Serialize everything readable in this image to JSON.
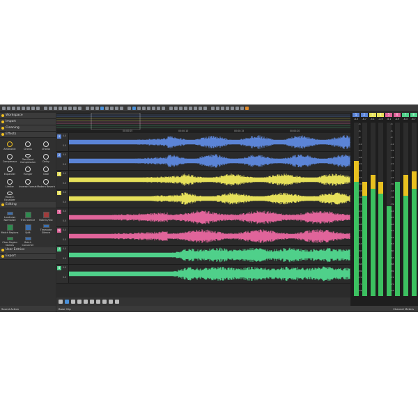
{
  "panel_sections": {
    "workspace": "Workspace",
    "import": "Import",
    "cleaning": "Cleaning",
    "effects": "Effects",
    "editing": "Editing",
    "user_entries": "User Entries",
    "export": "Export"
  },
  "effects": [
    "Ambisonic",
    "Chorus",
    "Chorus",
    "Compressor",
    "Two-Band Compression",
    "Delay",
    "Expander",
    "Flanger",
    "Gate",
    "Limiter",
    "Inverse Format",
    "Modern Reverb",
    "Modern Equalizer"
  ],
  "editing_tools": [
    "Loudness Normalize",
    "Trim Silence",
    "Fade In/Out",
    "Match Regions",
    "Split",
    "Timecode Silence",
    "Clear Region Names",
    "Batch Converter"
  ],
  "tracks": [
    {
      "num": "1",
      "color": "#5b84d6",
      "db_top": "0.0",
      "db_bottom": "0.0",
      "kind": "blue"
    },
    {
      "num": "2",
      "color": "#5b84d6",
      "db_top": "0.0",
      "db_bottom": "0.0",
      "kind": "blue"
    },
    {
      "num": "3",
      "color": "#e6e05a",
      "db_top": "0.0",
      "db_bottom": "0.0",
      "kind": "yellow"
    },
    {
      "num": "4",
      "color": "#e6e05a",
      "db_top": "0.0",
      "db_bottom": "0.0",
      "kind": "yellow"
    },
    {
      "num": "5",
      "color": "#e0649a",
      "db_top": "0.0",
      "db_bottom": "0.0",
      "kind": "pink"
    },
    {
      "num": "6",
      "color": "#e0649a",
      "db_top": "0.0",
      "db_bottom": "0.0",
      "kind": "pink"
    },
    {
      "num": "7",
      "color": "#4fd08a",
      "db_top": "0.0",
      "db_bottom": "0.0",
      "kind": "green"
    },
    {
      "num": "8",
      "color": "#4fd08a",
      "db_top": "0.0",
      "db_bottom": "0.0",
      "kind": "green"
    }
  ],
  "ruler_ticks": [
    "00:00:05",
    "00:00:10",
    "00:00:15",
    "00:00:20"
  ],
  "status": {
    "left": "Sound Action",
    "mid": "Base Clip",
    "right": "Channel Meters"
  },
  "meter_channels": [
    {
      "label": "1",
      "peak": "-6.3",
      "color": "#5b84d6",
      "level": 0.78,
      "yellow": 0.12
    },
    {
      "label": "2",
      "peak": "-6.7",
      "color": "#5b84d6",
      "level": 0.66,
      "yellow": 0.08
    },
    {
      "label": "3",
      "peak": "-5.1",
      "color": "#e6e05a",
      "level": 0.7,
      "yellow": 0.08
    },
    {
      "label": "4",
      "peak": "-4.9",
      "color": "#e6e05a",
      "level": 0.66,
      "yellow": 0.07
    },
    {
      "label": "5",
      "peak": "-6.1",
      "color": "#e0649a",
      "level": 0.52,
      "yellow": 0.0
    },
    {
      "label": "6",
      "peak": "-4.9",
      "color": "#e0649a",
      "level": 0.66,
      "yellow": 0.0
    },
    {
      "label": "7",
      "peak": "-6.3",
      "color": "#4fd08a",
      "level": 0.7,
      "yellow": 0.12
    },
    {
      "label": "8",
      "peak": "-6.7",
      "color": "#4fd08a",
      "level": 0.72,
      "yellow": 0.1
    }
  ],
  "meter_scale": [
    "-3",
    "-6",
    "-9",
    "-12",
    "-15",
    "-18",
    "-21",
    "-24",
    "-27",
    "-30",
    "-33",
    "-36",
    "-39",
    "-42",
    "-45",
    "-48",
    "-51",
    "-54",
    "-57",
    "-60",
    "-63",
    "-66",
    "-69",
    "-72",
    "-75",
    "-78"
  ]
}
